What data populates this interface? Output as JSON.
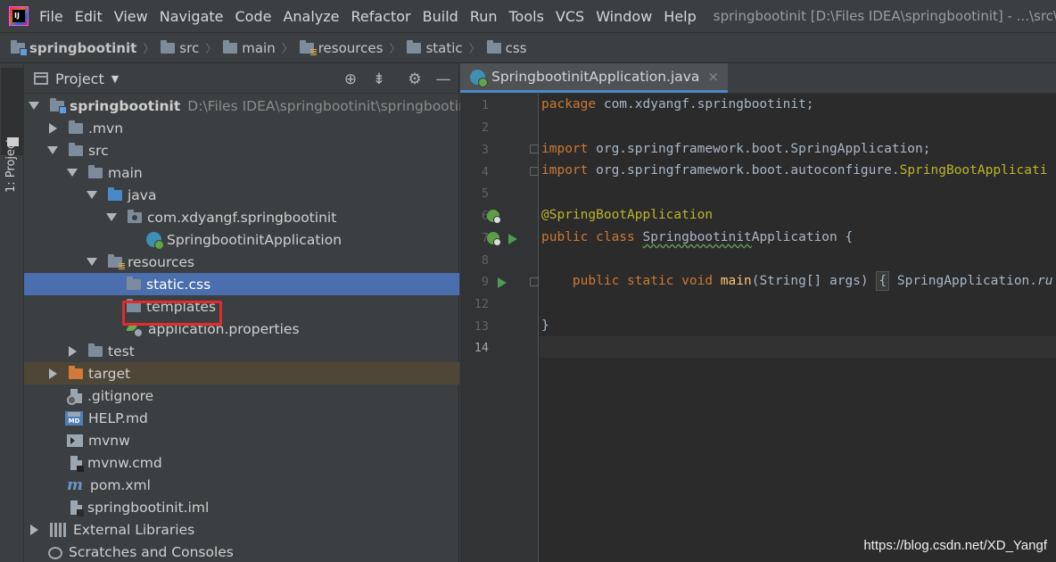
{
  "menubar": {
    "logo_text": "IJ",
    "items": [
      "File",
      "Edit",
      "View",
      "Navigate",
      "Code",
      "Analyze",
      "Refactor",
      "Build",
      "Run",
      "Tools",
      "VCS",
      "Window",
      "Help"
    ],
    "window_title": "springbootinit [D:\\Files IDEA\\springbootinit] - ...\\src\\mai"
  },
  "breadcrumb": [
    "springbootinit",
    "src",
    "main",
    "resources",
    "static",
    "css"
  ],
  "tool_strip": {
    "project_label": "1: Project"
  },
  "project_panel": {
    "title": "Project",
    "dropdown_icon": "chevron-down-icon",
    "header_buttons": [
      "locate-icon",
      "collapse-all-icon",
      "gear-icon",
      "hide-icon"
    ],
    "tree": [
      {
        "label": "springbootinit",
        "hint": "D:\\Files IDEA\\springbootinit\\springbootinit"
      },
      {
        "label": ".mvn"
      },
      {
        "label": "src"
      },
      {
        "label": "main"
      },
      {
        "label": "java"
      },
      {
        "label": "com.xdyangf.springbootinit"
      },
      {
        "label": "SpringbootinitApplication"
      },
      {
        "label": "resources"
      },
      {
        "label": "static.css",
        "selected": true
      },
      {
        "label": "templates"
      },
      {
        "label": "application.properties"
      },
      {
        "label": "test"
      },
      {
        "label": "target"
      },
      {
        "label": ".gitignore"
      },
      {
        "label": "HELP.md"
      },
      {
        "label": "mvnw"
      },
      {
        "label": "mvnw.cmd"
      },
      {
        "label": "pom.xml"
      },
      {
        "label": "springbootinit.iml"
      },
      {
        "label": "External Libraries"
      },
      {
        "label": "Scratches and Consoles"
      }
    ]
  },
  "editor": {
    "tab_label": "SpringbootinitApplication.java",
    "close_glyph": "×",
    "line_numbers": [
      "1",
      "2",
      "3",
      "4",
      "5",
      "6",
      "7",
      "8",
      "9",
      "12",
      "13",
      "14"
    ],
    "code": {
      "l1_kw": "package",
      "l1_rest": " com.xdyangf.springbootinit;",
      "l3_kw": "import",
      "l3_rest": " org.springframework.boot.SpringApplication;",
      "l4_kw": "import",
      "l4_rest": " org.springframework.boot.autoconfigure.",
      "l4_cls": "SpringBootApplicati",
      "l6_ann": "@SpringBootApplication",
      "l7_kw": "public class ",
      "l7_name": "Springbootinit",
      "l7_rest": "Application {",
      "l9_kw": "    public static void ",
      "l9_meth": "main",
      "l9_rest": "(String[] args) ",
      "l9_fold": "{",
      "l9_tail": " SpringApplication.",
      "l9_italic": "ru",
      "l13": "}"
    }
  },
  "watermark": "https://blog.csdn.net/XD_Yangf"
}
